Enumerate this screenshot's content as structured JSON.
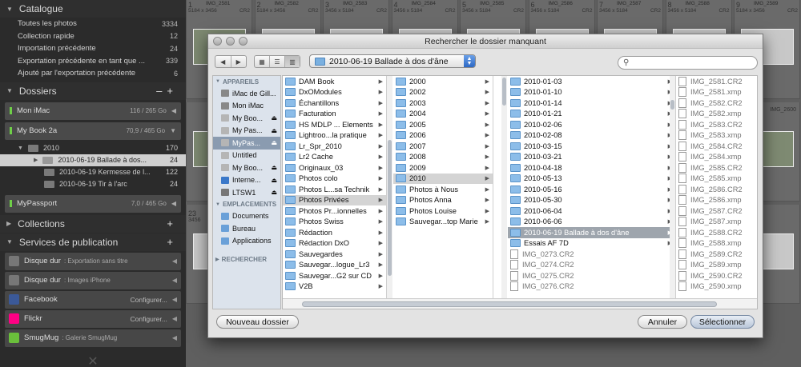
{
  "left_panel": {
    "catalogue": {
      "title": "Catalogue",
      "items": [
        {
          "label": "Toutes les photos",
          "count": "3334"
        },
        {
          "label": "Collection rapide",
          "count": "12"
        },
        {
          "label": "Importation précédente",
          "count": "24"
        },
        {
          "label": "Exportation précédente en tant que ...",
          "count": "339"
        },
        {
          "label": "Ajouté par l'exportation précédente",
          "count": "6"
        }
      ]
    },
    "dossiers": {
      "title": "Dossiers",
      "drives": [
        {
          "name": "Mon iMac",
          "size": "116 / 265 Go"
        },
        {
          "name": "My Book 2a",
          "size": "70,9 / 465 Go"
        },
        {
          "name": "MyPassport",
          "size": "7,0 / 465 Go"
        }
      ],
      "folders": [
        {
          "label": "2010",
          "count": "170"
        },
        {
          "label": "2010-06-19 Ballade à dos...",
          "count": "24"
        },
        {
          "label": "2010-06-19 Kermesse de l...",
          "count": "122"
        },
        {
          "label": "2010-06-19 Tir à l'arc",
          "count": "24"
        }
      ]
    },
    "collections": {
      "title": "Collections"
    },
    "publication": {
      "title": "Services de publication",
      "services": [
        {
          "name": "Disque dur",
          "sub": ": Exportation sans titre",
          "cfg": ""
        },
        {
          "name": "Disque dur",
          "sub": ": Images iPhone",
          "cfg": ""
        },
        {
          "name": "Facebook",
          "sub": "",
          "cfg": "Configurer..."
        },
        {
          "name": "Flickr",
          "sub": "",
          "cfg": "Configurer..."
        },
        {
          "name": "SmugMug",
          "sub": ": Galerie SmugMug",
          "cfg": ""
        }
      ]
    }
  },
  "grid": {
    "top_cells": [
      {
        "num": "1",
        "name": "IMG_2581",
        "dim": "5184 x 3456",
        "ext": "CR2"
      },
      {
        "num": "2",
        "name": "IMG_2582",
        "dim": "5184 x 3456",
        "ext": "CR2"
      },
      {
        "num": "3",
        "name": "IMG_2583",
        "dim": "3456 x 5184",
        "ext": "CR2"
      },
      {
        "num": "4",
        "name": "IMG_2584",
        "dim": "3456 x 5184",
        "ext": "CR2"
      },
      {
        "num": "5",
        "name": "IMG_2585",
        "dim": "3456 x 5184",
        "ext": "CR2"
      },
      {
        "num": "6",
        "name": "IMG_2586",
        "dim": "3456 x 5184",
        "ext": "CR2"
      },
      {
        "num": "7",
        "name": "IMG_2587",
        "dim": "3456 x 5184",
        "ext": "CR2"
      },
      {
        "num": "8",
        "name": "IMG_2588",
        "dim": "3456 x 5184",
        "ext": "CR2"
      },
      {
        "num": "9",
        "name": "IMG_2589",
        "dim": "5184 x 3456",
        "ext": "CR2"
      }
    ],
    "side_labels": {
      "r2": "IMG_2600",
      "r3a": "23",
      "r3b": "3456"
    }
  },
  "dialog": {
    "title": "Rechercher le dossier manquant",
    "nav_back": "◀",
    "nav_fwd": "▶",
    "view_icons": "▦",
    "view_list": "☰",
    "view_columns": "▥",
    "location": "2010-06-19 Ballade à dos d'âne",
    "search_placeholder": "",
    "sidebar": {
      "devices_title": "APPAREILS",
      "devices": [
        {
          "label": "iMac de Gill...",
          "eject": ""
        },
        {
          "label": "Mon iMac",
          "eject": ""
        },
        {
          "label": "My Boo...",
          "eject": "⏏"
        },
        {
          "label": "My Pas...",
          "eject": "⏏"
        },
        {
          "label": "MyPas...",
          "eject": "⏏"
        },
        {
          "label": "Untitled",
          "eject": ""
        },
        {
          "label": "My Boo...",
          "eject": "⏏"
        },
        {
          "label": "Interne...",
          "eject": "⏏"
        },
        {
          "label": "LTSW1",
          "eject": "⏏"
        }
      ],
      "places_title": "EMPLACEMENTS",
      "places": [
        "Documents",
        "Bureau",
        "Applications"
      ],
      "search_title": "RECHERCHER"
    },
    "columns": {
      "c1": [
        "DAM Book",
        "DxOModules",
        "Échantillons",
        "Facturation",
        "HS MDLP ... Elements",
        "Lightroo...la pratique",
        "Lr_Spr_2010",
        "Lr2 Cache",
        "Originaux_03",
        "Photos colo",
        "Photos L...sa Technik",
        "Photos Privées",
        "Photos Pr...ionnelles",
        "Photos Swiss",
        "Rédaction",
        "Rédaction DxO",
        "Sauvegardes",
        "Sauvegar...logue_Lr3",
        "Sauvegar...G2 sur CD",
        "V2B"
      ],
      "c2": [
        "2000",
        "2002",
        "2003",
        "2004",
        "2005",
        "2006",
        "2007",
        "2008",
        "2009",
        "2010",
        "Photos à Nous",
        "Photos Anna",
        "Photos Louise",
        "Sauvegar...top Marie"
      ],
      "c3_folders": [
        "2010-01-03",
        "2010-01-10",
        "2010-01-14",
        "2010-01-21",
        "2010-02-06",
        "2010-02-08",
        "2010-03-15",
        "2010-03-21",
        "2010-04-18",
        "2010-05-13",
        "2010-05-16",
        "2010-05-30",
        "2010-06-04",
        "2010-06-06",
        "2010-06-19 Ballade à dos d'âne",
        "Essais AF 7D"
      ],
      "c3_files": [
        "IMG_0273.CR2",
        "IMG_0274.CR2",
        "IMG_0275.CR2",
        "IMG_0276.CR2"
      ],
      "c4": [
        "IMG_2581.CR2",
        "IMG_2581.xmp",
        "IMG_2582.CR2",
        "IMG_2582.xmp",
        "IMG_2583.CR2",
        "IMG_2583.xmp",
        "IMG_2584.CR2",
        "IMG_2584.xmp",
        "IMG_2585.CR2",
        "IMG_2585.xmp",
        "IMG_2586.CR2",
        "IMG_2586.xmp",
        "IMG_2587.CR2",
        "IMG_2587.xmp",
        "IMG_2588.CR2",
        "IMG_2588.xmp",
        "IMG_2589.CR2",
        "IMG_2589.xmp",
        "IMG_2590.CR2",
        "IMG_2590.xmp"
      ]
    },
    "buttons": {
      "new_folder": "Nouveau dossier",
      "cancel": "Annuler",
      "select": "Sélectionner"
    }
  },
  "colors": {
    "accent": "#6fcf48",
    "selection": "#9ea5ad",
    "folder": "#8cbde9"
  }
}
